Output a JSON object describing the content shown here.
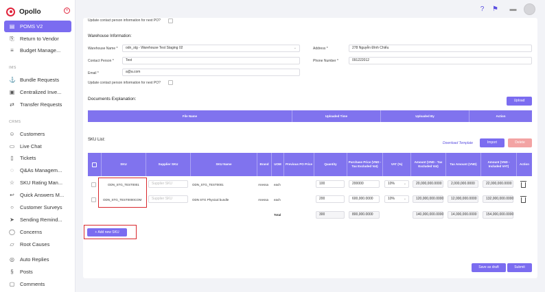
{
  "app": {
    "logo": "Opollo"
  },
  "sidebar": {
    "items": [
      {
        "label": "POMS V2",
        "icon": "clipboard-icon",
        "active": true
      },
      {
        "label": "Return to Vendor",
        "icon": "return-icon"
      },
      {
        "label": "Budget Manage...",
        "icon": "list-icon"
      },
      {
        "label": "Bundle Requests",
        "icon": "anchor-icon"
      },
      {
        "label": "Centralized Inve...",
        "icon": "inbox-icon"
      },
      {
        "label": "Transfer Requests",
        "icon": "transfer-icon"
      },
      {
        "label": "Customers",
        "icon": "users-icon"
      },
      {
        "label": "Live Chat",
        "icon": "chat-icon"
      },
      {
        "label": "Tickets",
        "icon": "ticket-icon"
      },
      {
        "label": "Q&As Managem...",
        "icon": "qa-icon"
      },
      {
        "label": "SKU Rating Man...",
        "icon": "star-icon"
      },
      {
        "label": "Quick Answers M...",
        "icon": "reply-icon"
      },
      {
        "label": "Customer Surveys",
        "icon": "survey-icon"
      },
      {
        "label": "Sending Remind...",
        "icon": "send-icon"
      },
      {
        "label": "Concerns",
        "icon": "concern-icon"
      },
      {
        "label": "Root Causes",
        "icon": "folder-icon"
      },
      {
        "label": "Auto Replies",
        "icon": "auto-reply-icon"
      },
      {
        "label": "Posts",
        "icon": "post-icon"
      },
      {
        "label": "Comments",
        "icon": "comment-icon"
      }
    ],
    "sections": {
      "ims": "IMS",
      "crms": "CRMS"
    }
  },
  "form": {
    "update_contact_top": "Update contact person information for next PO?",
    "warehouse_title": "Warehouse Information:",
    "warehouse_name_label": "Warehouse Name *",
    "warehouse_name_value": "odn_stg - Warehouse Test Staging 02",
    "address_label": "Address *",
    "address_value": "278 Nguyễn Đình Chiểu",
    "contact_person_label": "Contact Person *",
    "contact_person_value": "Test",
    "phone_label": "Phone Number *",
    "phone_value": "091222012",
    "email_label": "Email *",
    "email_value": "a@a.com",
    "update_contact_bottom": "Update contact person information for next PO?"
  },
  "documents": {
    "title": "Documents Explanation:",
    "upload_label": "Upload",
    "columns": [
      "File Name",
      "Uploaded Time",
      "Uploaded By",
      "Action"
    ]
  },
  "sku": {
    "title": "SKU List:",
    "download_template": "Download Template",
    "import_label": "Import",
    "delete_label": "Delete",
    "columns": [
      "SKU",
      "Supplier SKU",
      "SKU Name",
      "Brand",
      "UOM",
      "Previous PO Price",
      "Quantity",
      "Purchase Price (VND - Tax Excluded Vat)",
      "VAT (%)",
      "Amount (VND - Tax Excluded Vat)",
      "Tax Amount (VND)",
      "Amount (VND - Included VAT)",
      "Action"
    ],
    "supplier_sku_placeholder": "Supplier SKU",
    "rows": [
      {
        "sku": "ODN_STG_TEST0001",
        "name": "ODN_STG_TEST0001",
        "brand": "Anessa",
        "uom": "each",
        "qty": "100",
        "price": "200000",
        "vat": "10%",
        "amount": "20,000,000.0000",
        "tax": "2,000,000.0000",
        "total": "22,000,000.0000"
      },
      {
        "sku": "ODN_STG_TEST0000COM",
        "name": "ODN STG Physical bundle",
        "brand": "Anessa",
        "uom": "each",
        "qty": "200",
        "price": "600,000.0000",
        "vat": "10%",
        "amount": "120,000,000.0000",
        "tax": "12,000,000.0000",
        "total": "132,000,000.0000"
      }
    ],
    "total_label": "Total",
    "total_qty": "300",
    "total_price": "800,000.0000",
    "total_amount": "140,000,000.0000",
    "total_tax": "14,000,000.0000",
    "total_total": "154,000,000.0000",
    "add_label": "+ Add new SKU"
  },
  "footer": {
    "save_draft": "Save as draft",
    "submit": "Submit"
  }
}
